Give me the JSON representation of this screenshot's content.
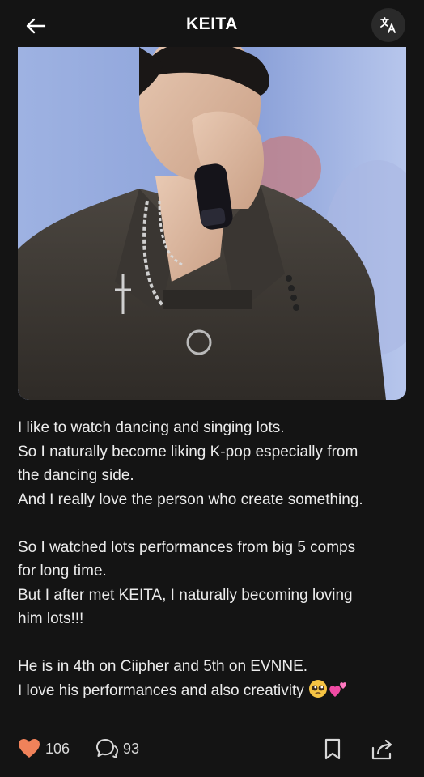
{
  "header": {
    "title": "KEITA"
  },
  "post": {
    "lines": [
      "I like to watch dancing and singing lots.",
      "So I naturally become liking K-pop especially from",
      "the dancing side.",
      "And I really love the person who create something.",
      "",
      "So I watched lots performances from big 5 comps",
      "for long time.",
      "But I after met KEITA, I naturally becoming loving",
      "him lots!!!",
      "",
      "He is in 4th on Ciipher and 5th on EVNNE.",
      "I love his performances and also creativity"
    ],
    "emojis": [
      "pleading-face",
      "two-hearts"
    ]
  },
  "actions": {
    "likes": "106",
    "comments": "93"
  },
  "colors": {
    "like": "#f0825a",
    "background": "#141414"
  },
  "icons": [
    "back-arrow-icon",
    "translate-icon",
    "heart-icon",
    "comment-icon",
    "bookmark-icon",
    "share-icon"
  ]
}
